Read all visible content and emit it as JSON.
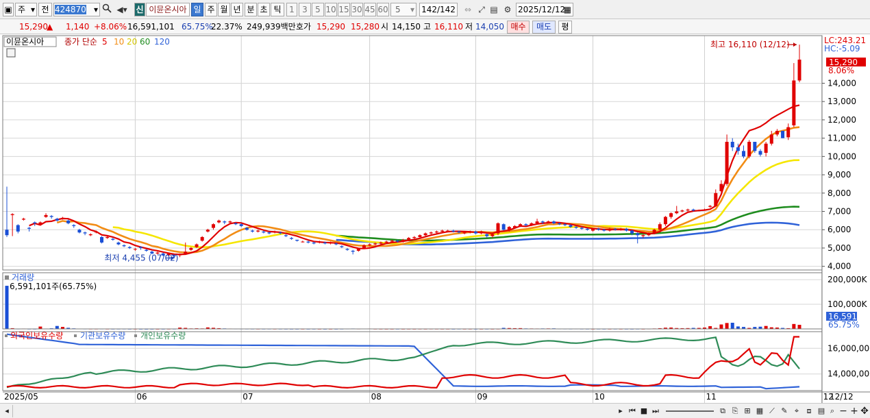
{
  "toolbar": {
    "market_label": "주",
    "prev_label": "전",
    "stock_code": "424870",
    "new_badge": "신",
    "stock_name": "이뮨온시아",
    "periods": [
      "일",
      "주",
      "월",
      "년",
      "분",
      "초",
      "틱"
    ],
    "minute_options": [
      "1",
      "3",
      "5",
      "10",
      "15",
      "30",
      "45",
      "60"
    ],
    "interval_value": "5",
    "count_display": "142/142",
    "date_value": "2025/12/12"
  },
  "info": {
    "price": "15,290",
    "change": "1,140",
    "change_pct": "+8.06%",
    "volume": "16,591,101",
    "volume_ratio": "65.75%",
    "turnover": "22.37%",
    "amount": "249,939백만",
    "quote_label": "호가",
    "ask": "15,290",
    "bid": "15,280",
    "open_label": "시",
    "open": "14,150",
    "high_label": "고",
    "high": "16,110",
    "low_label": "저",
    "low": "14,050",
    "buy_label": "매수",
    "sell_label": "매도",
    "avg_label": "평"
  },
  "colors": {
    "up": "#e00000",
    "down": "#1a4fd6",
    "ma5": "#e00000",
    "ma10": "#f28c14",
    "ma20": "#f5e600",
    "ma60": "#1e8c1e",
    "ma120": "#2f62d8",
    "foreign": "#e00000",
    "institution": "#2f62d8",
    "individual": "#2e8b57"
  },
  "chart_data": [
    {
      "type": "candlestick",
      "title": "이뮨온시아",
      "legend_prefix": "종가 단순",
      "ma_periods": [
        "5",
        "10",
        "20",
        "60",
        "120"
      ],
      "ylim": [
        3800,
        16600
      ],
      "y_ticks": [
        4000,
        5000,
        6000,
        7000,
        8000,
        9000,
        10000,
        11000,
        12000,
        13000,
        14000
      ],
      "y_tick_labels": [
        "4,000",
        "5,000",
        "6,000",
        "7,000",
        "8,000",
        "9,000",
        "10,000",
        "11,000",
        "12,000",
        "13,000",
        "14,000"
      ],
      "lc_label": "LC:243.21",
      "hc_label": "HC:-5.09",
      "current_price_label": "15,290",
      "current_pct_label": "8.06%",
      "high_annotation": "최고 16,110 (12/12)",
      "low_annotation": "최저 4,455 (07/02)",
      "x_labels": [
        "2025/05",
        "06",
        "07",
        "08",
        "09",
        "10",
        "11",
        "12"
      ],
      "x_label_days": [
        0,
        23,
        42,
        65,
        84,
        105,
        125,
        146
      ],
      "right_date": "12/12",
      "ma_start_day": {
        "5": 4,
        "10": 9,
        "20": 19,
        "60": 59,
        "120": 59
      },
      "closes": [
        5700,
        6850,
        5900,
        6600,
        6050,
        6350,
        6400,
        6800,
        6700,
        6500,
        6650,
        6350,
        6200,
        5850,
        5800,
        5750,
        5900,
        5300,
        5600,
        5450,
        5200,
        5100,
        5000,
        4950,
        5000,
        4850,
        4700,
        4750,
        4600,
        4700,
        4550,
        4650,
        4800,
        5000,
        5200,
        5600,
        6000,
        6300,
        6500,
        6400,
        6450,
        6300,
        6200,
        6000,
        5900,
        5950,
        5850,
        5800,
        5900,
        5800,
        5650,
        5500,
        5400,
        5350,
        5300,
        5250,
        5350,
        5250,
        5300,
        5200,
        5050,
        4900,
        4800,
        4950,
        5150,
        5200,
        5250,
        5300,
        5350,
        5400,
        5350,
        5450,
        5550,
        5600,
        5700,
        5800,
        5850,
        5900,
        5950,
        5950,
        5900,
        5850,
        5850,
        5900,
        5800,
        5900,
        5650,
        5750,
        6350,
        6000,
        6150,
        6200,
        6300,
        6250,
        6350,
        6450,
        6400,
        6450,
        6350,
        6300,
        6250,
        6150,
        6100,
        6050,
        6000,
        6050,
        6000,
        5950,
        6050,
        6000,
        6050,
        5950,
        5800,
        5700,
        5700,
        5800,
        6000,
        6300,
        6700,
        6900,
        7000,
        7050,
        7100,
        7050,
        7050,
        7100,
        7300,
        8000,
        8500,
        10800,
        10500,
        10300,
        10000,
        10800,
        10300,
        10100,
        10700,
        11200,
        11400,
        11000,
        11600,
        14150,
        15290
      ],
      "opens": [
        6000,
        6800,
        6250,
        6550,
        6100,
        6400,
        6300,
        6700,
        6750,
        6600,
        6600,
        6500,
        6250,
        6000,
        5850,
        5700,
        5850,
        5600,
        5550,
        5500,
        5300,
        5150,
        5050,
        4950,
        5050,
        4900,
        4800,
        4700,
        4700,
        4600,
        4600,
        4600,
        4700,
        4900,
        5050,
        5400,
        5900,
        6100,
        6400,
        6450,
        6400,
        6350,
        6300,
        6100,
        5950,
        5900,
        5900,
        5850,
        5850,
        5850,
        5700,
        5550,
        5450,
        5350,
        5350,
        5300,
        5300,
        5300,
        5250,
        5250,
        5100,
        4950,
        4850,
        4850,
        5000,
        5150,
        5200,
        5250,
        5300,
        5350,
        5400,
        5350,
        5450,
        5550,
        5600,
        5700,
        5800,
        5850,
        5900,
        5950,
        5950,
        5900,
        5800,
        5850,
        5900,
        5800,
        5750,
        5650,
        5800,
        6300,
        6000,
        6100,
        6200,
        6300,
        6250,
        6350,
        6450,
        6400,
        6450,
        6350,
        6300,
        6250,
        6150,
        6100,
        6050,
        5950,
        6050,
        6000,
        5950,
        6050,
        6000,
        6050,
        5950,
        5800,
        5650,
        5700,
        5800,
        6000,
        6300,
        6700,
        6900,
        7000,
        7050,
        7100,
        7050,
        7100,
        7250,
        7300,
        8100,
        8500,
        10800,
        10500,
        10300,
        10000,
        10800,
        10300,
        10200,
        10700,
        11200,
        11400,
        11050,
        11700,
        14150
      ],
      "highs": [
        8350,
        6900,
        6300,
        6650,
        6150,
        6450,
        6450,
        6900,
        6800,
        6650,
        6700,
        6550,
        6300,
        6050,
        5900,
        5800,
        5950,
        5650,
        5650,
        5550,
        5350,
        5200,
        5100,
        5000,
        5100,
        4950,
        4850,
        4800,
        4750,
        4750,
        4650,
        4700,
        5300,
        5050,
        5250,
        5650,
        6050,
        6350,
        6550,
        6500,
        6500,
        6400,
        6350,
        6150,
        6000,
        6000,
        5950,
        5900,
        5950,
        5900,
        5750,
        5600,
        5450,
        5400,
        5400,
        5350,
        5400,
        5350,
        5350,
        5300,
        5150,
        5000,
        4900,
        5000,
        5200,
        5250,
        5300,
        5350,
        5400,
        5450,
        5450,
        5500,
        5600,
        5650,
        5750,
        5850,
        5900,
        5950,
        6000,
        6000,
        6000,
        5950,
        5900,
        5950,
        5950,
        5950,
        5800,
        5800,
        6400,
        6350,
        6200,
        6250,
        6350,
        6350,
        6400,
        6600,
        6500,
        6500,
        6500,
        6400,
        6350,
        6300,
        6200,
        6150,
        6100,
        6100,
        6100,
        6050,
        6100,
        6100,
        6100,
        6100,
        6000,
        5850,
        5750,
        5850,
        6050,
        6400,
        6750,
        6950,
        7300,
        7100,
        7150,
        7150,
        7100,
        7150,
        7350,
        8200,
        8700,
        11200,
        11000,
        10700,
        10600,
        10900,
        10800,
        10400,
        10800,
        11400,
        11500,
        11400,
        11800,
        15100,
        16110
      ],
      "lows": [
        5600,
        5650,
        5800,
        6500,
        5900,
        6200,
        6250,
        6650,
        6600,
        6450,
        6550,
        6300,
        6100,
        5800,
        5700,
        5650,
        5800,
        5250,
        5500,
        5400,
        5150,
        5050,
        4950,
        4850,
        4900,
        4800,
        4650,
        4650,
        4550,
        4550,
        4455,
        4500,
        4650,
        4850,
        5000,
        5350,
        5850,
        6000,
        6350,
        6300,
        6350,
        6250,
        6150,
        5950,
        5850,
        5850,
        5800,
        5750,
        5800,
        5750,
        5600,
        5450,
        5350,
        5300,
        5250,
        5200,
        5250,
        5200,
        5200,
        5150,
        5000,
        4850,
        4650,
        4800,
        4950,
        5100,
        5150,
        5200,
        5250,
        5300,
        5300,
        5300,
        5400,
        5500,
        5550,
        5650,
        5750,
        5800,
        5850,
        5900,
        5850,
        5800,
        5750,
        5800,
        5750,
        5750,
        5550,
        5550,
        5700,
        5950,
        5900,
        6050,
        6150,
        6200,
        6200,
        6300,
        6300,
        6350,
        6300,
        6250,
        6200,
        6100,
        6050,
        6000,
        5950,
        5900,
        5950,
        5900,
        5900,
        5950,
        5950,
        5900,
        5700,
        5250,
        5550,
        5650,
        5750,
        5950,
        6200,
        6600,
        6850,
        6950,
        7000,
        7000,
        7000,
        7050,
        7200,
        7300,
        8000,
        8400,
        10300,
        10100,
        9900,
        9900,
        10200,
        10000,
        10000,
        10600,
        11100,
        11000,
        10900,
        11600,
        14050
      ],
      "ma_labels_end": {
        "5": 12800,
        "10": 11600,
        "20": 9800,
        "60": 7250,
        "120": 6250
      }
    },
    {
      "type": "bar",
      "title": "거래량",
      "annotation": "6,591,101주(65.75%)",
      "y_tick_labels": [
        "200,000K",
        "100,000K"
      ],
      "y_ticks": [
        200000,
        100000
      ],
      "ylim": [
        0,
        228000
      ],
      "current_label": "16,591K",
      "current_pct_label": "65.75%",
      "values_k": [
        175000,
        3000,
        1200,
        1500,
        900,
        800,
        9500,
        1500,
        2500,
        12000,
        8000,
        4500,
        2200,
        1400,
        1200,
        1000,
        1000,
        1200,
        900,
        800,
        900,
        1000,
        700,
        800,
        600,
        500,
        600,
        600,
        700,
        800,
        900,
        5200,
        4200,
        2000,
        2500,
        2000,
        6000,
        4500,
        3000,
        2000,
        1500,
        1300,
        1200,
        1100,
        1000,
        900,
        900,
        1000,
        900,
        900,
        800,
        700,
        700,
        800,
        700,
        800,
        700,
        600,
        700,
        700,
        900,
        1300,
        1600,
        1200,
        1400,
        1500,
        900,
        800,
        700,
        700,
        800,
        700,
        800,
        700,
        900,
        800,
        1000,
        900,
        800,
        800,
        700,
        900,
        800,
        800,
        700,
        700,
        800,
        700,
        900,
        4200,
        3500,
        3000,
        3200,
        2000,
        1800,
        1600,
        1900,
        2000,
        2200,
        1300,
        1200,
        1100,
        1300,
        1000,
        900,
        800,
        900,
        800,
        800,
        900,
        800,
        800,
        700,
        900,
        800,
        1200,
        1800,
        3000,
        5000,
        5500,
        3500,
        3000,
        3300,
        4100,
        4000,
        5500,
        11000,
        4000,
        18000,
        24000,
        25000,
        10000,
        8000,
        4000,
        8000,
        9000,
        12000,
        6500,
        5500,
        4000,
        3000,
        20000,
        16591
      ]
    },
    {
      "type": "line",
      "title": "외국인보유수량",
      "series": [
        {
          "name": "외국인보유수량",
          "color_key": "foreign"
        },
        {
          "name": "기관보유수량",
          "color_key": "institution"
        },
        {
          "name": "개인보유수량",
          "color_key": "individual"
        }
      ],
      "y_tick_labels": [
        "16,000,000",
        "14,000,000"
      ],
      "y_ticks": [
        16000000,
        14000000
      ],
      "ylim": [
        12700000,
        17300000
      ]
    }
  ]
}
